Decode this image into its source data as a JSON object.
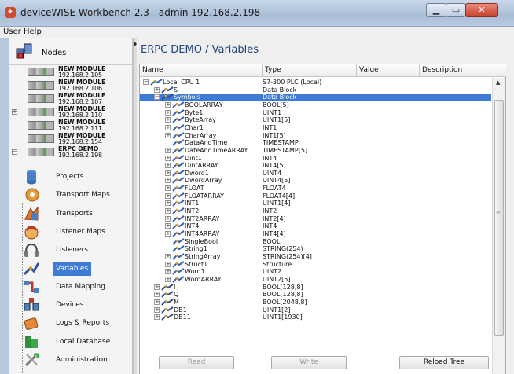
{
  "window": {
    "title": "deviceWISE Workbench 2.3  -  admin 192.168.2.198"
  },
  "menu": {
    "user": "User",
    "help": "Help"
  },
  "sidebar": {
    "nodes_label": "Nodes",
    "modules": [
      {
        "name": "NEW MODULE",
        "ip": "192.168.2.105"
      },
      {
        "name": "NEW MODULE",
        "ip": "192.168.2.106"
      },
      {
        "name": "NEW MODULE",
        "ip": "192.168.2.107"
      },
      {
        "name": "NEW MODULE",
        "ip": "192.168.2.110"
      },
      {
        "name": "NEW MODULE",
        "ip": "192.168.2.111"
      },
      {
        "name": "NEW MODULE",
        "ip": "192.168.2.154"
      },
      {
        "name": "ERPC DEMO",
        "ip": "192.168.2.198"
      }
    ],
    "nav": [
      {
        "label": "Projects",
        "icon": "projects-icon"
      },
      {
        "label": "Transport Maps",
        "icon": "transport-maps-icon"
      },
      {
        "label": "Transports",
        "icon": "transports-icon"
      },
      {
        "label": "Listener Maps",
        "icon": "listener-maps-icon"
      },
      {
        "label": "Listeners",
        "icon": "listeners-icon"
      },
      {
        "label": "Variables",
        "icon": "variables-icon"
      },
      {
        "label": "Data Mapping",
        "icon": "data-mapping-icon"
      },
      {
        "label": "Devices",
        "icon": "devices-icon"
      },
      {
        "label": "Logs & Reports",
        "icon": "logs-reports-icon"
      },
      {
        "label": "Local Database",
        "icon": "local-database-icon"
      },
      {
        "label": "Administration",
        "icon": "administration-icon"
      }
    ]
  },
  "main": {
    "heading": "ERPC DEMO / Variables",
    "columns": {
      "name": "Name",
      "type": "Type",
      "value": "Value",
      "description": "Description"
    },
    "rows": [
      {
        "name": "Local CPU 1",
        "type": "S7-300 PLC (Local)"
      },
      {
        "name": "S",
        "type": "Data Block"
      },
      {
        "name": "Symbols",
        "type": "Data Block"
      },
      {
        "name": "BOOLARRAY",
        "type": "BOOL[5]"
      },
      {
        "name": "Byte1",
        "type": "UINT1"
      },
      {
        "name": "ByteArray",
        "type": "UINT1[5]"
      },
      {
        "name": "Char1",
        "type": "INT1"
      },
      {
        "name": "CharArray",
        "type": "INT1[5]"
      },
      {
        "name": "DataAndTime",
        "type": "TIMESTAMP"
      },
      {
        "name": "DateAndTimeARRAY",
        "type": "TIMESTAMP[5]"
      },
      {
        "name": "Dint1",
        "type": "INT4"
      },
      {
        "name": "DintARRAY",
        "type": "INT4[5]"
      },
      {
        "name": "Dword1",
        "type": "UINT4"
      },
      {
        "name": "DwordArray",
        "type": "UINT4[5]"
      },
      {
        "name": "FLOAT",
        "type": "FLOAT4"
      },
      {
        "name": "FLOATARRAY",
        "type": "FLOAT4[4]"
      },
      {
        "name": "INT1",
        "type": "UINT1[4]"
      },
      {
        "name": "INT2",
        "type": "INT2"
      },
      {
        "name": "INT2ARRAY",
        "type": "INT2[4]"
      },
      {
        "name": "INT4",
        "type": "INT4"
      },
      {
        "name": "INT4ARRAY",
        "type": "INT4[4]"
      },
      {
        "name": "SingleBool",
        "type": "BOOL"
      },
      {
        "name": "String1",
        "type": "STRING(254)"
      },
      {
        "name": "StringArray",
        "type": "STRING(254)[4]"
      },
      {
        "name": "Struct1",
        "type": "Structure"
      },
      {
        "name": "Word1",
        "type": "UINT2"
      },
      {
        "name": "WordARRAY",
        "type": "UINT2[5]"
      },
      {
        "name": "I",
        "type": "BOOL[128,8]"
      },
      {
        "name": "Q",
        "type": "BOOL[128,8]"
      },
      {
        "name": "M",
        "type": "BOOL[2048,8]"
      },
      {
        "name": "DB1",
        "type": "UINT1[2]"
      },
      {
        "name": "DB11",
        "type": "UINT1[1930]"
      }
    ],
    "buttons": {
      "read": "Read",
      "write": "Write",
      "reload": "Reload Tree"
    }
  },
  "colors": {
    "selection": "#3d7bd6",
    "heading": "#1d3f7a"
  }
}
